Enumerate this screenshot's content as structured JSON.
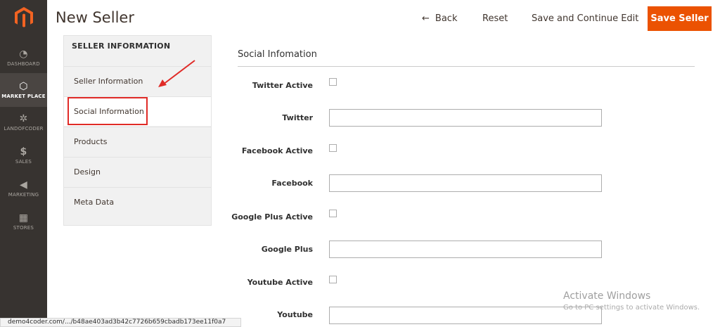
{
  "app": {
    "page_title": "New Seller"
  },
  "nav": {
    "items": [
      {
        "label": "DASHBOARD",
        "icon": "dashboard-icon"
      },
      {
        "label": "MARKET PLACE",
        "icon": "hexagon-icon"
      },
      {
        "label": "LANDOFCODER",
        "icon": "landofcoder-icon"
      },
      {
        "label": "SALES",
        "icon": "dollar-icon"
      },
      {
        "label": "MARKETING",
        "icon": "megaphone-icon"
      },
      {
        "label": "STORES",
        "icon": "store-icon"
      }
    ]
  },
  "header": {
    "back_label": "Back",
    "reset_label": "Reset",
    "save_continue_label": "Save and Continue Edit",
    "save_label": "Save Seller"
  },
  "tabs": {
    "heading": "SELLER INFORMATION",
    "items": [
      {
        "label": "Seller Information"
      },
      {
        "label": "Social Information"
      },
      {
        "label": "Products"
      },
      {
        "label": "Design"
      },
      {
        "label": "Meta Data"
      }
    ]
  },
  "section": {
    "title": "Social Infomation"
  },
  "fields": {
    "twitter_active": "Twitter Active",
    "twitter": "Twitter",
    "facebook_active": "Facebook Active",
    "facebook": "Facebook",
    "googleplus_active": "Google Plus Active",
    "googleplus": "Google Plus",
    "youtube_active": "Youtube Active",
    "youtube": "Youtube"
  },
  "watermark": {
    "title": "Activate Windows",
    "subtitle": "Go to PC settings to activate Windows."
  },
  "statusbar": {
    "url": "demo4coder.com/.../b48ae403ad3b42c7726b659cbadb173ee11f0a7"
  },
  "colors": {
    "accent": "#eb5202",
    "nav_bg": "#373330",
    "highlight": "#e02b27"
  }
}
